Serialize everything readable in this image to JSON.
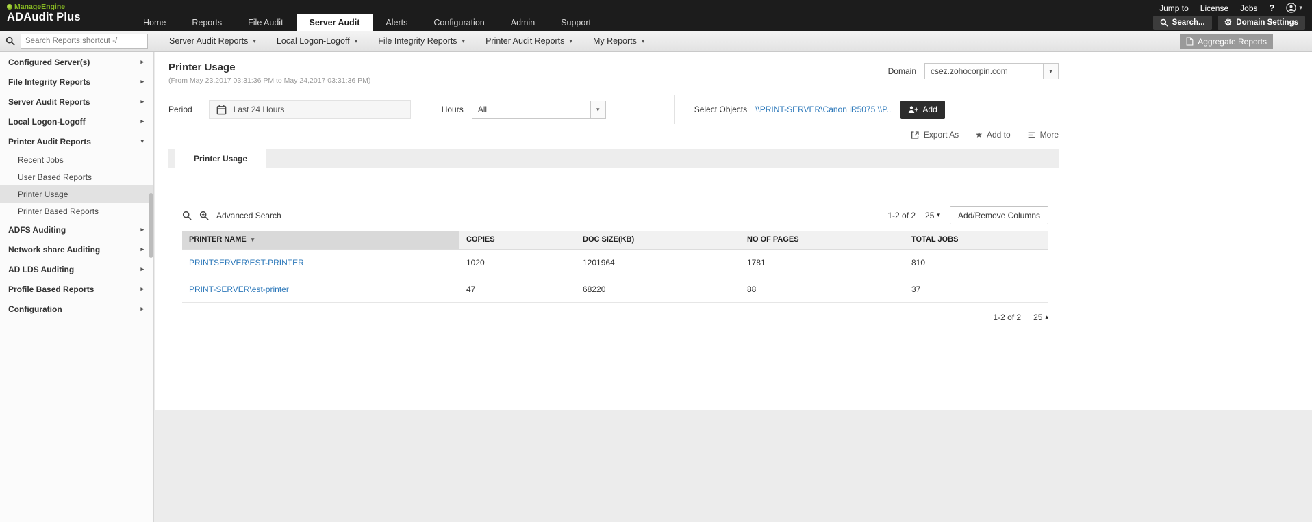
{
  "topbar": {
    "brand_line1": "ManageEngine",
    "brand_line2": "ADAudit Plus",
    "link_jump_to": "Jump to",
    "link_license": "License",
    "link_jobs": "Jobs",
    "tabs": [
      {
        "label": "Home"
      },
      {
        "label": "Reports"
      },
      {
        "label": "File Audit"
      },
      {
        "label": "Server Audit"
      },
      {
        "label": "Alerts"
      },
      {
        "label": "Configuration"
      },
      {
        "label": "Admin"
      },
      {
        "label": "Support"
      }
    ],
    "active_tab": "Server Audit",
    "search_label": "Search...",
    "domain_settings_label": "Domain Settings"
  },
  "menubar": {
    "search_placeholder": "Search Reports;shortcut -/",
    "menus": [
      {
        "label": "Server Audit Reports"
      },
      {
        "label": "Local Logon-Logoff"
      },
      {
        "label": "File Integrity Reports"
      },
      {
        "label": "Printer Audit Reports"
      },
      {
        "label": "My Reports"
      }
    ],
    "aggregate_label": "Aggregate Reports"
  },
  "sidebar": {
    "items": [
      {
        "label": "Configured Server(s)"
      },
      {
        "label": "File Integrity Reports"
      },
      {
        "label": "Server Audit Reports"
      },
      {
        "label": "Local Logon-Logoff"
      },
      {
        "label": "Printer Audit Reports"
      },
      {
        "label": "ADFS Auditing"
      },
      {
        "label": "Network share Auditing"
      },
      {
        "label": "AD LDS Auditing"
      },
      {
        "label": "Profile Based Reports"
      },
      {
        "label": "Configuration"
      }
    ],
    "printer_children": [
      {
        "label": "Recent Jobs"
      },
      {
        "label": "User Based Reports"
      },
      {
        "label": "Printer Usage"
      },
      {
        "label": "Printer Based Reports"
      }
    ],
    "selected_child": "Printer Usage"
  },
  "main": {
    "title": "Printer Usage",
    "subtitle": "(From May 23,2017 03:31:36 PM to May 24,2017 03:31:36 PM)",
    "domain_label": "Domain",
    "domain_value": "csez.zohocorpin.com",
    "period_label": "Period",
    "period_value": "Last 24 Hours",
    "hours_label": "Hours",
    "hours_value": "All",
    "select_objects_label": "Select Objects",
    "select_objects_value": "\\\\PRINT-SERVER\\Canon iR5075 \\\\P..",
    "add_button_label": "Add",
    "export_as_label": "Export As",
    "add_to_label": "Add to",
    "more_label": "More",
    "active_report_tab": "Printer Usage",
    "advanced_search_label": "Advanced Search",
    "pagination_top": "1-2 of 2",
    "page_size_top": "25",
    "add_remove_columns_label": "Add/Remove Columns",
    "table": {
      "columns": [
        "PRINTER NAME",
        "COPIES",
        "DOC SIZE(KB)",
        "NO OF PAGES",
        "TOTAL JOBS"
      ],
      "rows": [
        [
          "PRINTSERVER\\EST-PRINTER",
          "1020",
          "1201964",
          "1781",
          "810"
        ],
        [
          "PRINT-SERVER\\est-printer",
          "47",
          "68220",
          "88",
          "37"
        ]
      ]
    },
    "pagination_bottom": "1-2 of 2",
    "page_size_bottom": "25"
  },
  "colors": {
    "topbar_bg": "#1c1c1c",
    "brand_green": "#86b822",
    "link_blue": "#2e79ba",
    "selected_sidebar_bg": "#e2e2e2",
    "header_cell_bg": "#d9d9d9"
  }
}
